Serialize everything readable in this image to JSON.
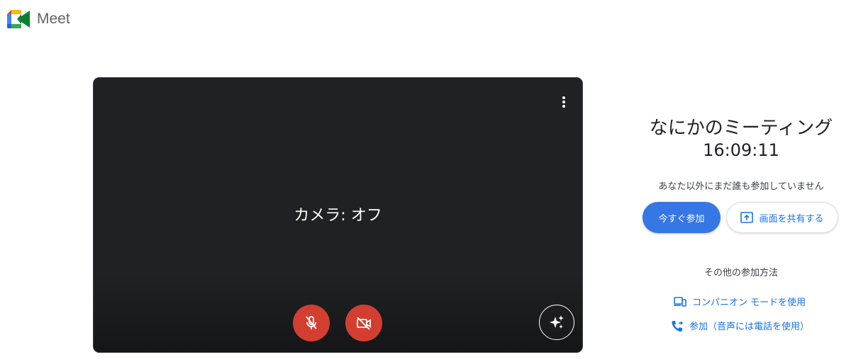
{
  "app": {
    "title": "Meet"
  },
  "preview": {
    "camera_status": "カメラ: オフ",
    "icons": {
      "more": "more-vert-icon",
      "mic": "mic-off-icon",
      "camera": "videocam-off-icon",
      "effects": "sparkle-effects-icon"
    },
    "button_color": "#d23f31"
  },
  "meeting": {
    "title": "なにかのミーティング",
    "time": "16:09:11",
    "status": "あなた以外にまだ誰も参加していません"
  },
  "actions": {
    "join_label": "今すぐ参加",
    "present_label": "画面を共有する"
  },
  "other_ways": {
    "heading": "その他の参加方法",
    "companion_label": "コンパニオン モードを使用",
    "phone_label": "参加（音声には電話を使用）"
  },
  "colors": {
    "primary": "#3577e5",
    "link": "#1a73e8"
  }
}
